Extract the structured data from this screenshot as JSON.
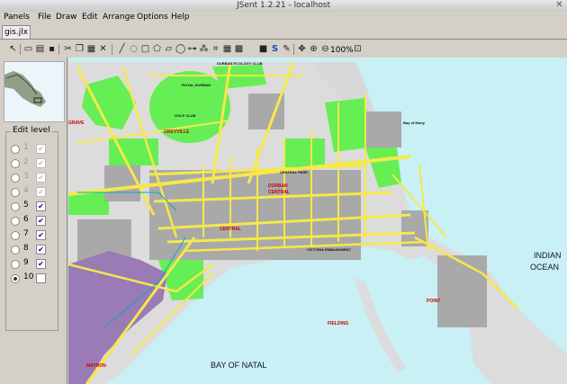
{
  "window": {
    "title": "JSent 1.2.21 - localhost",
    "close_glyph": "✕"
  },
  "menu": [
    "Panels",
    "File",
    "Draw",
    "Edit",
    "Arrange",
    "Options",
    "Help"
  ],
  "tab": {
    "label": "gis.jlx"
  },
  "toolbar": {
    "zoom_label": "100%"
  },
  "edit_level": {
    "legend": "Edit level",
    "levels": [
      {
        "num": "1",
        "enabled": false,
        "checked": true
      },
      {
        "num": "2",
        "enabled": false,
        "checked": true
      },
      {
        "num": "3",
        "enabled": false,
        "checked": true
      },
      {
        "num": "4",
        "enabled": false,
        "checked": true
      },
      {
        "num": "5",
        "enabled": true,
        "checked": true
      },
      {
        "num": "6",
        "enabled": true,
        "checked": true
      },
      {
        "num": "7",
        "enabled": true,
        "checked": true
      },
      {
        "num": "8",
        "enabled": true,
        "checked": true
      },
      {
        "num": "9",
        "enabled": true,
        "checked": true
      },
      {
        "num": "10",
        "enabled": true,
        "checked": false,
        "selected": true
      }
    ]
  },
  "map": {
    "labels": {
      "bay": "BAY OF NATAL",
      "ocean1": "INDIAN",
      "ocean2": "OCEAN",
      "greyville": "GREYVILLE",
      "durban_central": "DURBAN",
      "durban_central2": "CENTRAL",
      "central": "CENTRAL",
      "point": "POINT",
      "grave": "GRAVE",
      "royal_durban": "ROYAL DURBAN",
      "durban_ecology": "DURBAN ECOLOGY CLUB",
      "golf_club": "GOLF CLUB",
      "victoria_embankment": "VICTORIA EMBANKMENT",
      "central_park": "CENTRAL PARK",
      "beach_front": "BEACHFRONT",
      "bay_of_marty": "Bay of Marty",
      "mayron": "MAYRON",
      "fielding": "FIELDING"
    },
    "colors": {
      "water": "#c8f0f5",
      "land": "#dcdcdc",
      "road": "#f6e84a",
      "park": "#66ee55",
      "industrial": "#9a7bb5",
      "block": "#a9a9a9"
    }
  }
}
